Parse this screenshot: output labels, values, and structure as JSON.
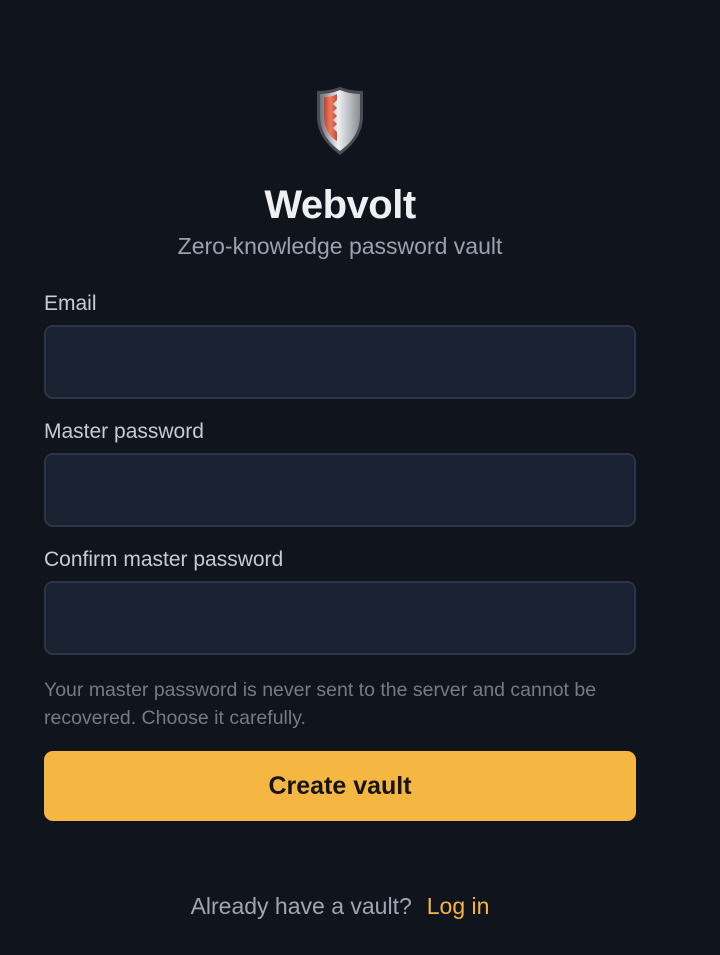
{
  "brand": {
    "name": "Webvolt",
    "tagline": "Zero-knowledge password vault",
    "logo_icon": "shield-icon",
    "accent_color": "#f5b642"
  },
  "form": {
    "email_label": "Email",
    "email_value": "",
    "password_label": "Master password",
    "password_value": "",
    "confirm_label": "Confirm master password",
    "confirm_value": "",
    "hint": "Your master password is never sent to the server and cannot be recovered. Choose it carefully.",
    "submit_label": "Create vault"
  },
  "footer": {
    "prompt": "Already have a vault?",
    "link_label": "Log in"
  }
}
